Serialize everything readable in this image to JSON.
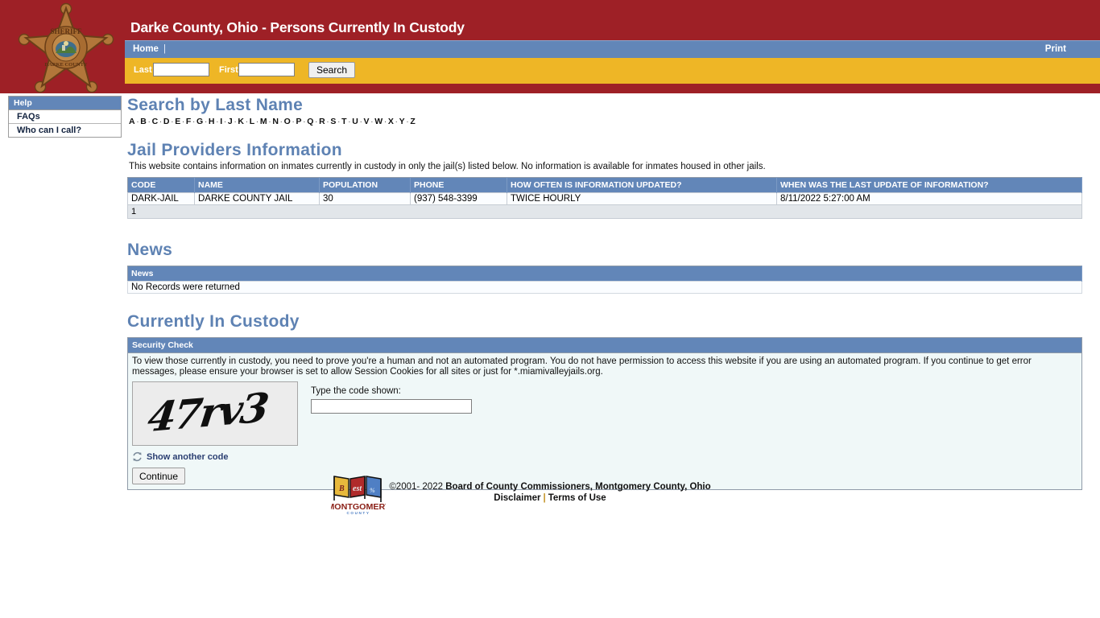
{
  "header": {
    "title": "Darke County, Ohio - Persons Currently In Custody",
    "badge_icon": "sheriff-star-badge-icon",
    "badge_text_top": "SHERIFF",
    "badge_text_bottom": "DARKE COUNTY",
    "nav": {
      "home_label": "Home",
      "separator": "|",
      "print_label": "Print"
    },
    "search": {
      "last_label": "Last",
      "last_value": "",
      "last_placeholder": "",
      "first_label": "First",
      "first_value": "",
      "first_placeholder": "",
      "button_label": "Search"
    },
    "colors": {
      "banner_red": "#9e2026",
      "nav_blue": "#6286b8",
      "search_gold": "#eeb626"
    }
  },
  "sidebar": {
    "heading": "Help",
    "items": [
      {
        "label": "FAQs"
      },
      {
        "label": "Who can I call?"
      }
    ]
  },
  "search_by_last_name": {
    "title": "Search by Last Name",
    "letters": [
      "A",
      "B",
      "C",
      "D",
      "E",
      "F",
      "G",
      "H",
      "I",
      "J",
      "K",
      "L",
      "M",
      "N",
      "O",
      "P",
      "Q",
      "R",
      "S",
      "T",
      "U",
      "V",
      "W",
      "X",
      "Y",
      "Z"
    ],
    "separator": "·"
  },
  "jail_providers": {
    "title": "Jail Providers Information",
    "description": "This website contains information on inmates currently in custody in only the jail(s) listed below. No information is available for inmates housed in other jails.",
    "columns": [
      "CODE",
      "NAME",
      "POPULATION",
      "PHONE",
      "HOW OFTEN IS INFORMATION UPDATED?",
      "WHEN WAS THE LAST UPDATE OF INFORMATION?"
    ],
    "rows": [
      {
        "code": "DARK-JAIL",
        "name": "DARKE COUNTY JAIL",
        "population": "30",
        "phone": "(937) 548-3399",
        "how_often": "TWICE HOURLY",
        "last_update": "8/11/2022 5:27:00 AM"
      }
    ],
    "pager": "1"
  },
  "news": {
    "title": "News",
    "column": "News",
    "empty_message": "No Records were returned"
  },
  "currently_in_custody": {
    "title": "Currently In Custody",
    "security_check": {
      "heading": "Security Check",
      "message": "To view those currently in custody, you need to prove you're a human and not an automated program. You do not have permission to access this website if you are using an automated program. If you continue to get error messages, please ensure your browser is set to allow Session Cookies for all sites or just for *.miamivalleyjails.org.",
      "captcha_code": "47rv3",
      "code_label": "Type the code shown:",
      "code_value": "",
      "code_placeholder": "",
      "refresh_icon": "refresh-circular-arrows-icon",
      "refresh_label": "Show another code",
      "continue_label": "Continue"
    }
  },
  "footer": {
    "logo_icon": "montgomery-county-flags-logo",
    "logo_text": "MONTGOMERY",
    "logo_subtext": "C O U N T Y",
    "copyright_prefix": "©2001- 2022 ",
    "copyright_org": "Board of County Commissioners, Montgomery County, Ohio",
    "disclaimer_label": "Disclaimer",
    "links_separator": "|",
    "terms_label": "Terms of Use"
  }
}
